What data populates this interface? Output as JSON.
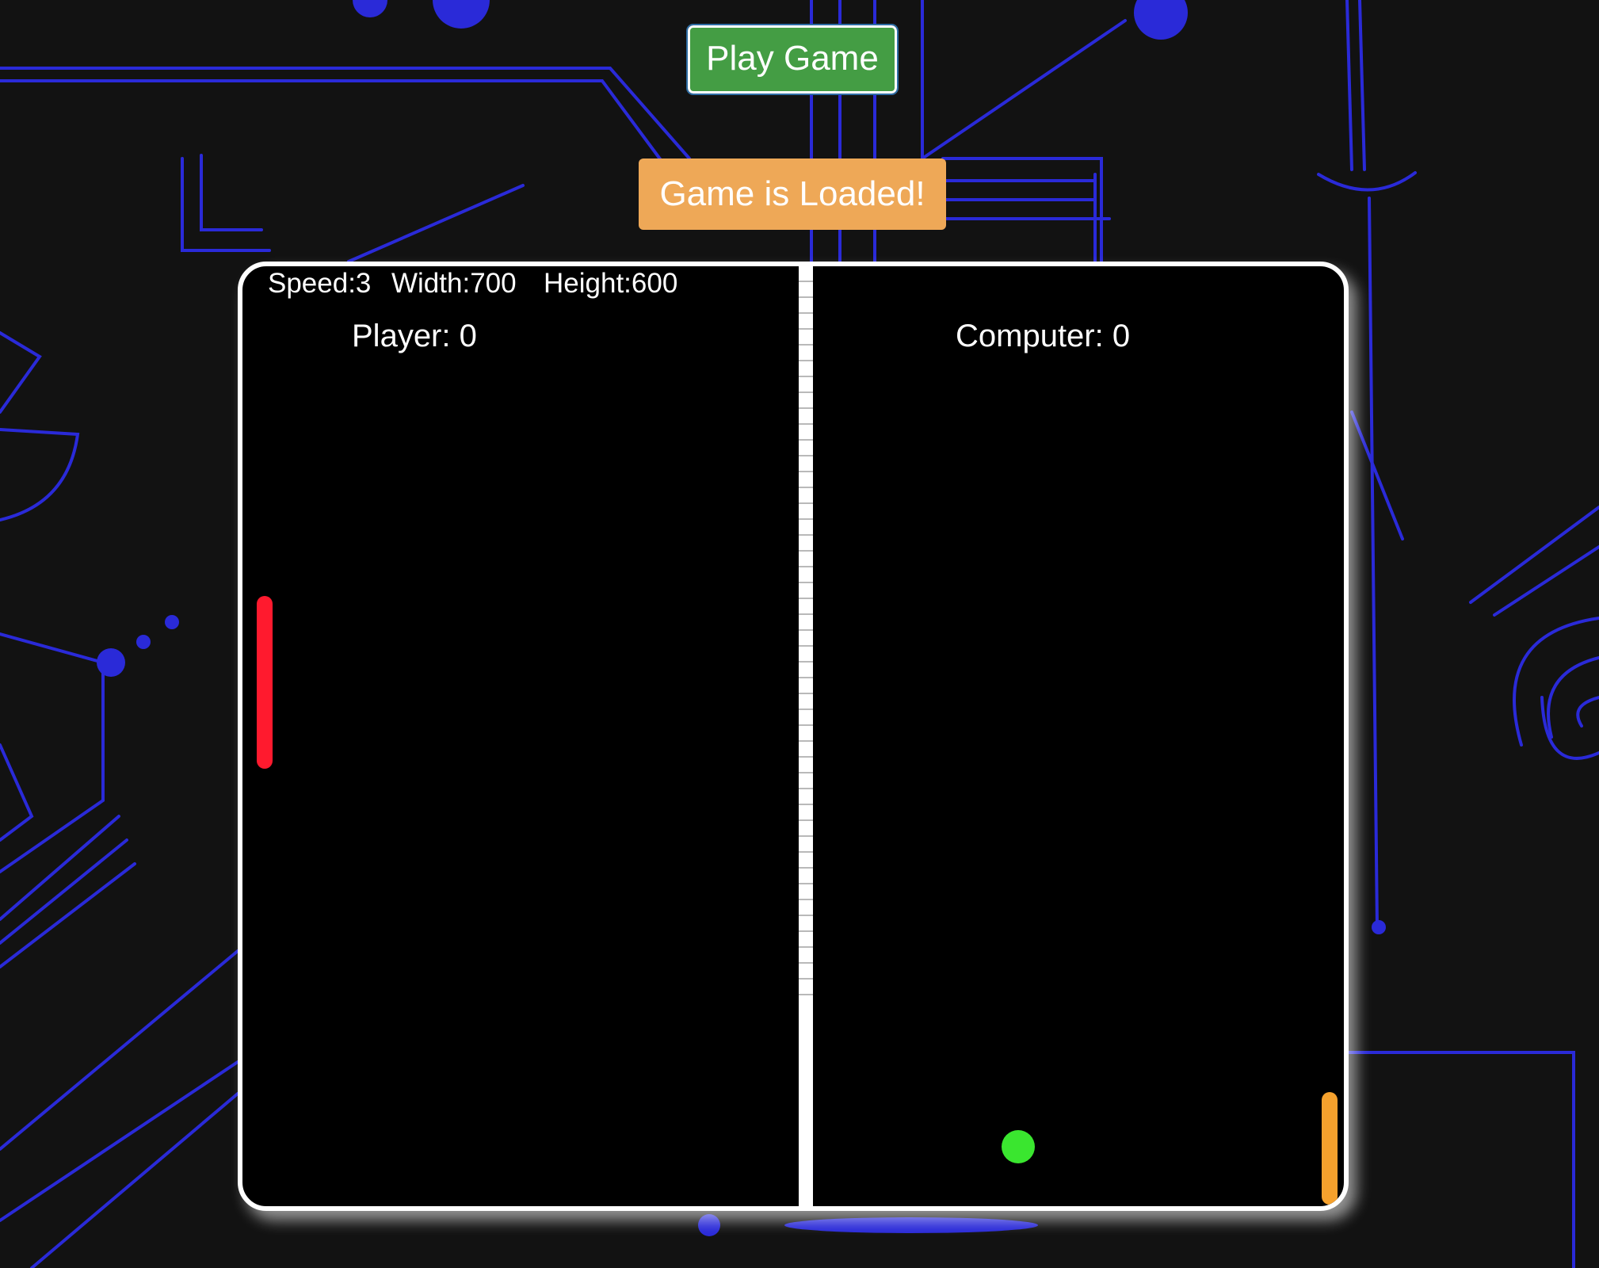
{
  "controls": {
    "play_label": "Play Game",
    "loaded_label": "Game is Loaded!"
  },
  "board": {
    "speed_text": "Speed:3",
    "width_text": "Width:700",
    "height_text": "Height:600",
    "player_score_text": "Player: 0",
    "computer_score_text": "Computer: 0"
  },
  "colors": {
    "page_background": "#121212",
    "background_art": "#2a2ad8",
    "play_button": "#449d44",
    "loaded_badge": "#eea857",
    "player_paddle": "#ff1a2e",
    "computer_paddle": "#f5a12d",
    "ball": "#3ae62f"
  }
}
